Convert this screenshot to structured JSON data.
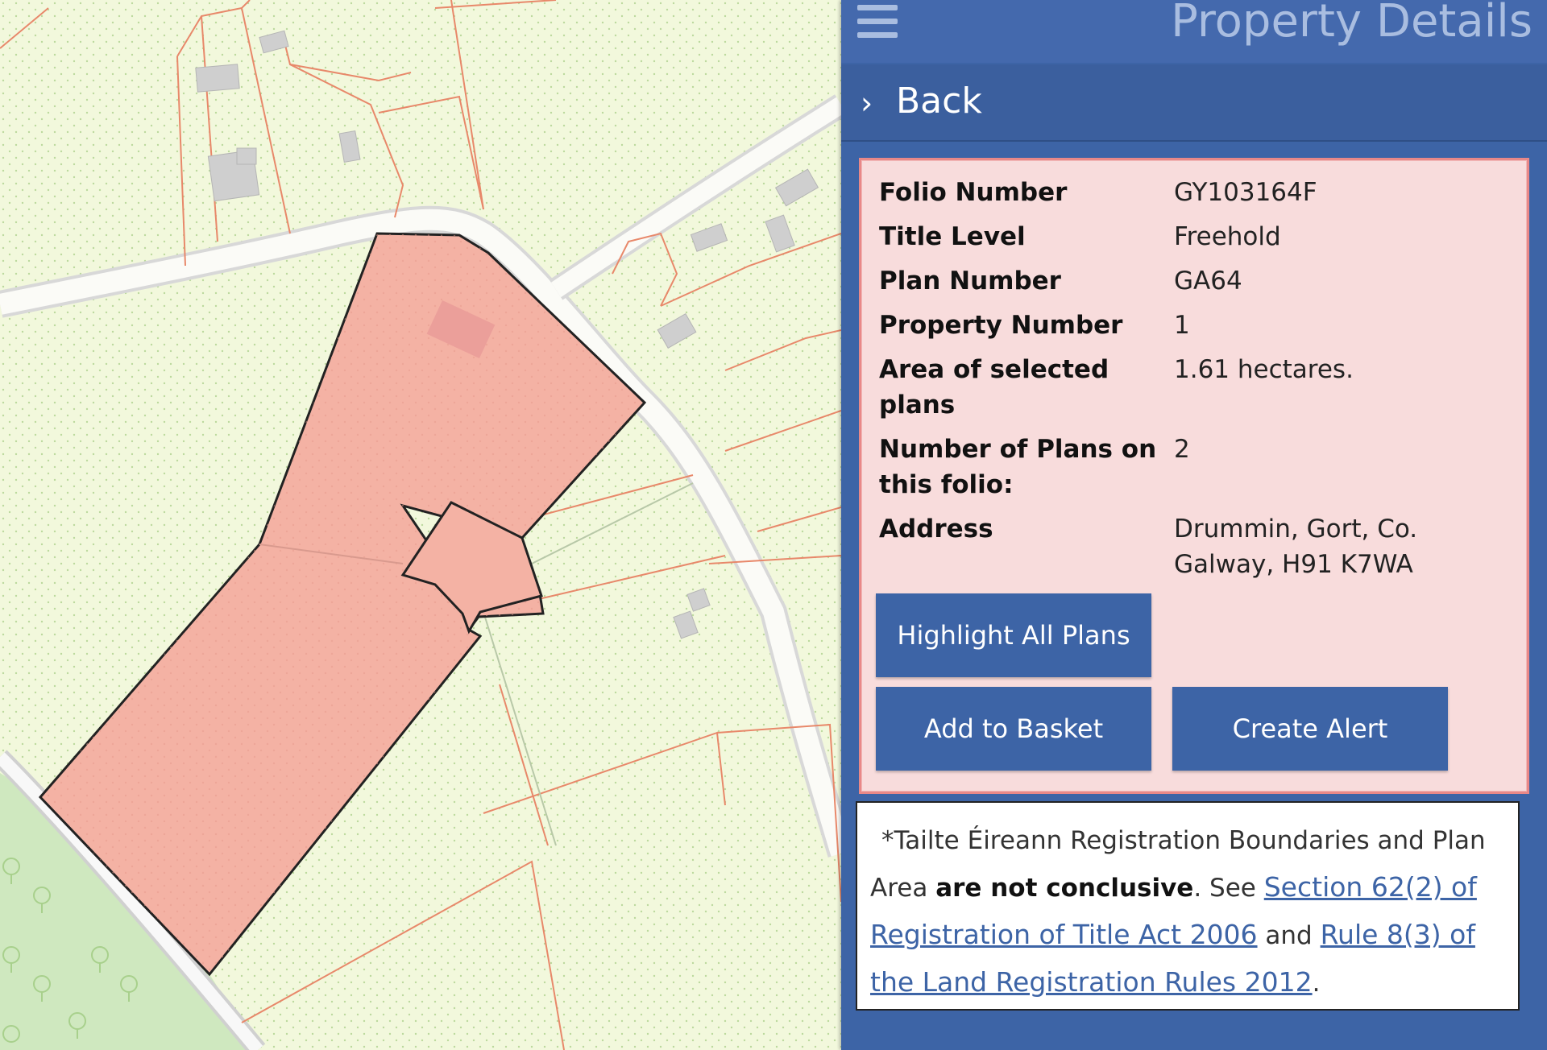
{
  "panel": {
    "title": "Property Details",
    "menu_icon": "hamburger-menu-icon",
    "back_icon": "chevron-right-icon",
    "back_label": "Back"
  },
  "details": [
    {
      "label": "Folio Number",
      "value": "GY103164F"
    },
    {
      "label": "Title Level",
      "value": "Freehold"
    },
    {
      "label": "Plan Number",
      "value": "GA64"
    },
    {
      "label": "Property Number",
      "value": "1"
    },
    {
      "label": "Area of selected plans",
      "value": "1.61 hectares."
    },
    {
      "label": "Number of Plans on this folio:",
      "value": "2"
    },
    {
      "label": "Address",
      "value": "Drummin, Gort, Co. Galway, H91 K7WA"
    }
  ],
  "buttons": {
    "highlight_all": "Highlight All Plans",
    "add_basket": "Add to Basket",
    "create_alert": "Create Alert"
  },
  "notice": {
    "prefix": "*Tailte Éireann Registration Boundaries and Plan Area ",
    "bold": "are not conclusive",
    "mid": ". See ",
    "link1": "Section 62(2) of Registration of Title Act 2006",
    "and": " and ",
    "link2": "Rule 8(3) of the Land Registration Rules 2012",
    "suffix": "."
  },
  "colors": {
    "panel": "#3d64a6",
    "details_bg": "#f8dcdc",
    "details_border": "#e88888",
    "map_background": "#f2f8dc",
    "parcel_fill": "#f4b2a4",
    "boundary_line": "#e8886a",
    "forest": "#cfe8bf"
  }
}
